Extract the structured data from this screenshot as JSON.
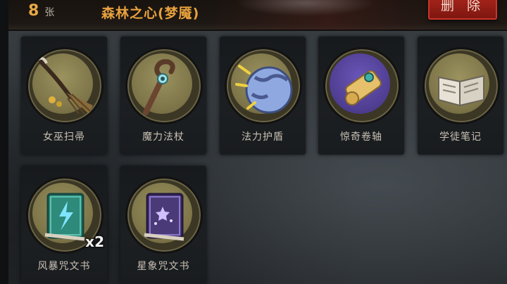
{
  "header": {
    "card_count": "8",
    "count_unit": "张",
    "deck_name": "森林之心(梦魇)",
    "delete_label": "删 除"
  },
  "cards": [
    {
      "name": "女巫扫帚",
      "icon": "broom-icon"
    },
    {
      "name": "魔力法杖",
      "icon": "staff-icon"
    },
    {
      "name": "法力护盾",
      "icon": "shield-orb-icon"
    },
    {
      "name": "惊奇卷轴",
      "icon": "scroll-icon"
    },
    {
      "name": "学徒笔记",
      "icon": "open-book-icon"
    },
    {
      "name": "风暴咒文书",
      "icon": "storm-spellbook-icon",
      "quantity": "x2"
    },
    {
      "name": "星象咒文书",
      "icon": "star-spellbook-icon"
    }
  ],
  "colors": {
    "accent_orange": "#e7a13e",
    "delete_red": "#a9251b",
    "medal_gold": "#9b925f"
  }
}
